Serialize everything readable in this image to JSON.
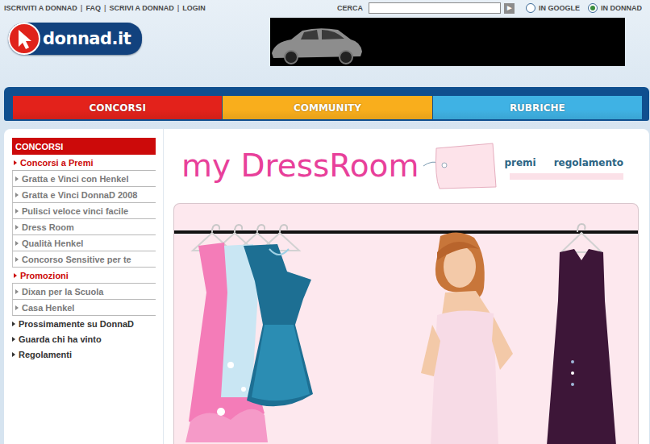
{
  "top_links": [
    "ISCRIVITI A DONNAD",
    "FAQ",
    "SCRIVI A DONNAD",
    "LOGIN"
  ],
  "top_separator": "|",
  "search": {
    "label": "CERCA",
    "button": "▶"
  },
  "search_scope": [
    {
      "label": "IN GOOGLE",
      "selected": false
    },
    {
      "label": "IN DONNAD",
      "selected": true
    }
  ],
  "logo": "donnad.it",
  "nav": [
    {
      "label": "CONCORSI",
      "color": "#e3221b"
    },
    {
      "label": "COMMUNITY",
      "color": "#f9ae1c"
    },
    {
      "label": "RUBRICHE",
      "color": "#3fb2e4"
    }
  ],
  "sidebar": {
    "title": "CONCORSI",
    "items": [
      {
        "label": "Concorsi a Premi",
        "kind": "section"
      },
      {
        "label": "Gratta e Vinci con Henkel",
        "kind": "item"
      },
      {
        "label": "Gratta e Vinci DonnaD 2008",
        "kind": "item"
      },
      {
        "label": "Pulisci veloce vinci facile",
        "kind": "item"
      },
      {
        "label": "Dress Room",
        "kind": "item"
      },
      {
        "label": "Qualità Henkel",
        "kind": "item"
      },
      {
        "label": "Concorso Sensitive per te",
        "kind": "item"
      },
      {
        "label": "Promozioni",
        "kind": "section"
      },
      {
        "label": "Dixan per la Scuola",
        "kind": "item"
      },
      {
        "label": "Casa Henkel",
        "kind": "item"
      },
      {
        "label": "Prossimamente su DonnaD",
        "kind": "link"
      },
      {
        "label": "Guarda chi ha vinto",
        "kind": "link"
      },
      {
        "label": "Regolamenti",
        "kind": "link"
      }
    ]
  },
  "page": {
    "title": "my DressRoom",
    "links": [
      "premi",
      "regolamento"
    ]
  }
}
